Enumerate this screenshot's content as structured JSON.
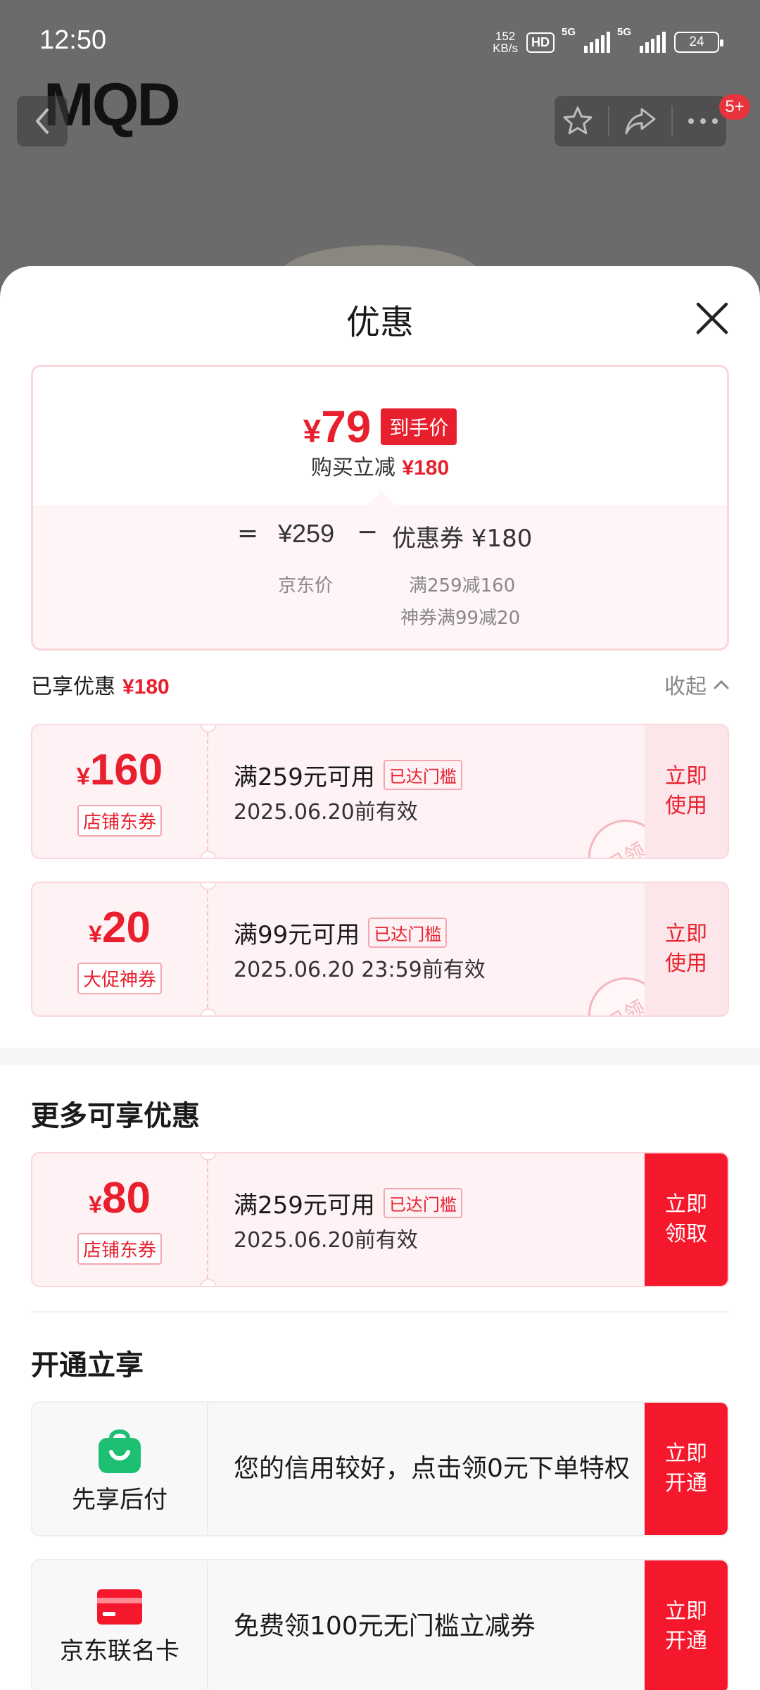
{
  "status_bar": {
    "time": "12:50",
    "net_speed": "152",
    "net_unit": "KB/s",
    "hd": "HD",
    "sim1": "5G",
    "sim2": "5G",
    "battery": "24"
  },
  "background": {
    "brand_logo": "MQD",
    "cart_badge": "5+"
  },
  "sheet": {
    "title": "优惠",
    "summary": {
      "currency": "¥",
      "final_price": "79",
      "final_tag": "到手价",
      "save_label": "购买立减",
      "save_amount": "¥180",
      "eq": "=",
      "list_price": "¥259",
      "minus": "−",
      "coupon_text": "优惠券 ¥180",
      "list_price_label": "京东价",
      "coupon_cond_1": "满259减160",
      "coupon_cond_2": "神券满99减20"
    },
    "enjoyed": {
      "label": "已享优惠",
      "amount": "¥180",
      "collapse": "收起"
    },
    "enjoyed_coupons": [
      {
        "currency": "¥",
        "amount": "160",
        "type": "店铺东券",
        "condition": "满259元可用",
        "reached": "已达门槛",
        "valid": "2025.06.20前有效",
        "action": "立即\n使用",
        "stamp": "已领"
      },
      {
        "currency": "¥",
        "amount": "20",
        "type": "大促神券",
        "condition": "满99元可用",
        "reached": "已达门槛",
        "valid": "2025.06.20 23:59前有效",
        "action": "立即\n使用",
        "stamp": "已领"
      }
    ],
    "more": {
      "title": "更多可享优惠",
      "coupon": {
        "currency": "¥",
        "amount": "80",
        "type": "店铺东券",
        "condition": "满259元可用",
        "reached": "已达门槛",
        "valid": "2025.06.20前有效",
        "action": "立即\n领取"
      }
    },
    "open": {
      "title": "开通立享",
      "services": [
        {
          "name": "先享后付",
          "desc": "您的信用较好，点击领0元下单特权",
          "action": "立即\n开通"
        },
        {
          "name": "京东联名卡",
          "desc": "免费领100元无门槛立减券",
          "action": "立即\n开通"
        }
      ]
    }
  },
  "colors": {
    "accent": "#e8202e",
    "button_red": "#f5182d",
    "coupon_bg": "#fff2f4"
  }
}
